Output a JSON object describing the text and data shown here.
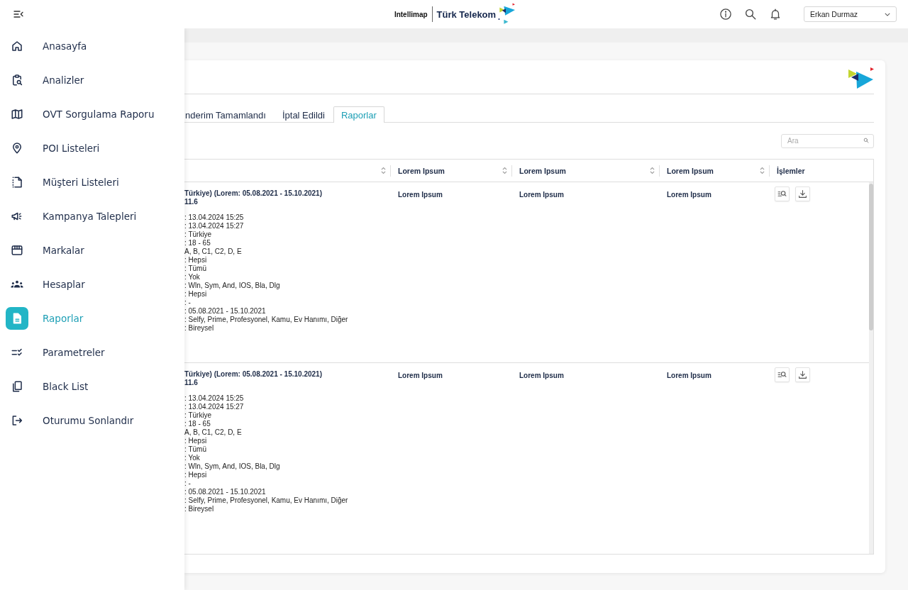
{
  "header": {
    "brand": "Intellimap",
    "logo_text": "Türk Telekom",
    "user": "Erkan Durmaz"
  },
  "sidebar": {
    "items": [
      {
        "label": "Anasayfa",
        "selected": false
      },
      {
        "label": "Analizler",
        "selected": false
      },
      {
        "label": "OVT Sorgulama Raporu",
        "selected": false
      },
      {
        "label": "POI Listeleri",
        "selected": false
      },
      {
        "label": "Müşteri Listeleri",
        "selected": false
      },
      {
        "label": "Kampanya Talepleri",
        "selected": false
      },
      {
        "label": "Markalar",
        "selected": false
      },
      {
        "label": "Hesaplar",
        "selected": false
      },
      {
        "label": "Raporlar",
        "selected": true
      },
      {
        "label": "Parametreler",
        "selected": false
      },
      {
        "label": "Black List",
        "selected": false
      },
      {
        "label": "Oturumu Sonlandır",
        "selected": false
      }
    ]
  },
  "tabs": [
    {
      "label": "nderim Tamamlandı",
      "selected": false
    },
    {
      "label": "İptal Edildi",
      "selected": false
    },
    {
      "label": "Raporlar",
      "selected": true
    }
  ],
  "search": {
    "placeholder": "Ara"
  },
  "table": {
    "columns": [
      {
        "sortable": true
      },
      {
        "label": "Lorem Ipsum",
        "sortable": true
      },
      {
        "label": "Lorem Ipsum",
        "sortable": true
      },
      {
        "label": "Lorem Ipsum",
        "sortable": true
      },
      {
        "label": "İşlemler",
        "sortable": false
      }
    ],
    "rows": [
      {
        "cells": [
          {
            "title": "Türkiye) (Lorem: 05.08.2021 - 15.10.2021)",
            "subtitle": "11.6",
            "details": [
              ": 13.04.2024 15:25",
              ": 13.04.2024 15:27",
              ": Türkiye",
              ": 18 - 65",
              "A, B, C1, C2, D, E",
              ": Hepsi",
              ": Tümü",
              ": Yok",
              ": Wln, Sym, And, IOS, Bla, Dlg",
              ": Hepsi",
              ": -",
              ": 05.08.2021 - 15.10.2021",
              ": Selfy, Prime, Profesyonel, Kamu, Ev Hanımı, Diğer",
              ": Bireysel"
            ]
          },
          "Lorem Ipsum",
          "Lorem Ipsum",
          "Lorem Ipsum"
        ]
      },
      {
        "cells": [
          {
            "title": "Türkiye) (Lorem: 05.08.2021 - 15.10.2021)",
            "subtitle": "11.6",
            "details": [
              ": 13.04.2024 15:25",
              ": 13.04.2024 15:27",
              ": Türkiye",
              ": 18 - 65",
              "A, B, C1, C2, D, E",
              ": Hepsi",
              ": Tümü",
              ": Yok",
              ": Wln, Sym, And, IOS, Bla, Dlg",
              ": Hepsi",
              ": -",
              ": 05.08.2021 - 15.10.2021",
              ": Selfy, Prime, Profesyonel, Kamu, Ev Hanımı, Diğer",
              ": Bireysel"
            ]
          },
          "Lorem Ipsum",
          "Lorem Ipsum",
          "Lorem Ipsum"
        ]
      }
    ]
  }
}
